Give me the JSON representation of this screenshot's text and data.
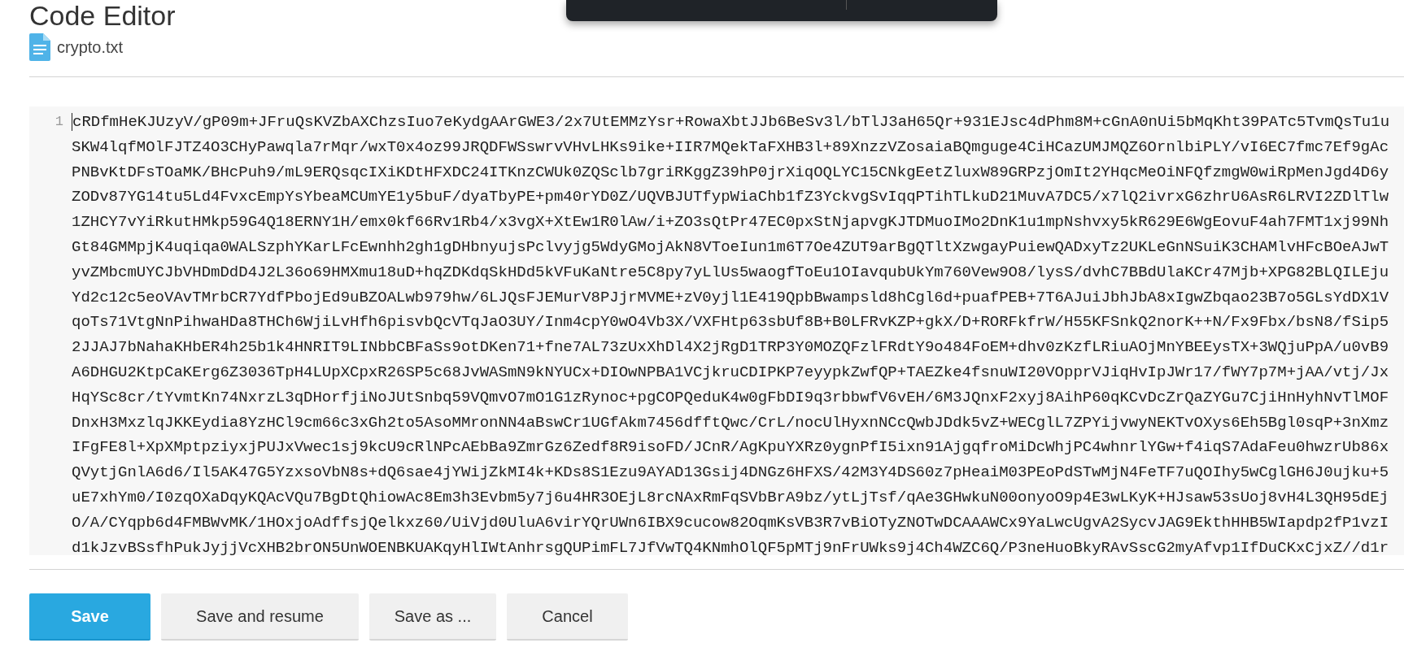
{
  "title": "Code Editor",
  "file": {
    "name": "crypto.txt"
  },
  "editor": {
    "lines": [
      {
        "number": "1",
        "cursor": true,
        "rows": [
          "cRDfmHeKJUzyV/gP09m+JFruQsKVZbAXChzsIuo7eKydgAArGWE3/2x7UtEMMzYsr+RowaXbtJJb6BeSv3l/bTlJ3aH65Qr+931EJsc4dPhm8M+cGnA0nUi5bMqKht39PATc5TvmQsTu1u",
          "SKW4lqfMOlFJTZ4O3CHyPawqla7rMqr/wxT0x4oz99JRQDFWSswrvVHvLHKs9ike+IIR7MQekTaFXHB3l+89XnzzVZosaiaBQmguge4CiHCazUMJMQZ6OrnlbiPLY/vI6EC7fmc7Ef9gAc",
          "PNBvKtDFsTOaMK/BHcPuh9/mL9ERQsqcIXiKDtHFXDC24ITKnzCWUk0ZQSclb7griRKggZ39hP0jrXiqOQLYC15CNkgEetZluxW89GRPzjOmIt2YHqcMeOiNFQfzmgW0wiRpMenJgd4D6y",
          "ZODv87YG14tu5Ld4FvxcEmpYsYbeaMCUmYE1y5buF/dyaTbyPE+pm40rYD0Z/UQVBJUTfypWiaChb1fZ3YckvgSvIqqPTihTLkuD21MuvA7DC5/x7lQ2ivrxG6zhrU6AsR6LRVI2ZDlTlw",
          "1ZHCY7vYiRkutHMkp59G4Q18ERNY1H/emx0kf66Rv1Rb4/x3vgX+XtEw1R0lAw/i+ZO3sQtPr47EC0pxStNjapvgKJTDMuoIMo2DnK1u1mpNshvxy5kR629E6WgEovuF4ah7FMT1xj99Nh",
          "Gt84GMMpjK4uqiqa0WALSzphYKarLFcEwnhh2gh1gDHbnyujsPclvyjg5WdyGMojAkN8VToeIun1m6T7Oe4ZUT9arBgQTltXzwgayPuiewQADxyTz2UKLeGnNSuiK3CHAMlvHFcBOeAJwT",
          "yvZMbcmUYCJbVHDmDdD4J2L36o69HMXmu18uD+hqZDKdqSkHDd5kVFuKaNtre5C8py7yLlUs5waogfToEu1OIavqubUkYm760Vew9O8/lysS/dvhC7BBdUlaKCr47Mjb+XPG82BLQILEju",
          "Yd2c12c5eoVAvTMrbCR7YdfPbojEd9uBZOALwb979hw/6LJQsFJEMurV8PJjrMVME+zV0yjl1E419QpbBwampsld8hCgl6d+puafPEB+7T6AJuiJbhJbA8xIgwZbqao23B7o5GLsYdDX1V",
          "qoTs71VtgNnPihwaHDa8THCh6WjiLvHfh6pisvbQcVTqJaO3UY/Inm4cpY0wO4Vb3X/VXFHtp63sbUf8B+B0LFRvKZP+gkX/D+RORFkfrW/H55KFSnkQ2norK++N/Fx9Fbx/bsN8/fSip5",
          "2JJAJ7bNahaKHbER4h25b1k4HNRIT9LINbbCBFaSs9otDKen71+fne7AL73zUxXhDl4X2jRgD1TRP3Y0MOZQFzlFRdtY9o484FoEM+dhv0zKzfLRiuAOjMnYBEEysTX+3WQjuPpA/u0vB9",
          "A6DHGU2KtpCaKErg6Z3036TpH4LUpXCpxR26SP5c68JvWASmN9kNYUCx+DIOwNPBA1VCjkruCDIPKP7eyypkZwfQP+TAEZke4fsnuWI20VOpprVJiqHvIpJWr17/fWY7p7M+jAA/vtj/Jx",
          "HqYSc8cr/tYvmtKn74NxrzL3qDHorfjiNoJUtSnbq59VQmvO7mO1G1zRynoc+pgCOPQeduK4w0gFbDI9q3rbbwfV6vEH/6M3JQnxF2xyj8AihP60qKCvDcZrQaZYGu7CjiHnHyhNvTlMOF",
          "DnxH3MxzlqJKKEydia8YzHCl9cm66c3xGh2to5AsoMMronNN4aBswCr1UGfAkm7456dfftQwc/CrL/nocUlHyxnNCcQwbJDdk5vZ+WECglL7ZPYijvwyNEKTvOXys6Eh5Bgl0sqP+3nXmz",
          "IFgFE8l+XpXMptpziyxjPUJxVwec1sj9kcU9cRlNPcAEbBa9ZmrGz6Zedf8R9isoFD/JCnR/AgKpuYXRz0ygnPfI5ixn91AjgqfroMiDcWhjPC4whnrlYGw+f4iqS7AdaFeu0hwzrUb86x",
          "QVytjGnlA6d6/Il5AK47G5YzxsoVbN8s+dQ6sae4jYWijZkMI4k+KDs8S1Ezu9AYAD13Gsij4DNGz6HFXS/42M3Y4DS60z7pHeaiM03PEoPdSTwMjN4FeTF7uQOIhy5wCglGH6J0ujku+5",
          "uE7xhYm0/I0zqOXaDqyKQAcVQu7BgDtQhiowAc8Em3h3Evbm5y7j6u4HR3OEjL8rcNAxRmFqSVbBrA9bz/ytLjTsf/qAe3GHwkuN00onyoO9p4E3wLKyK+HJsaw53sUoj8vH4L3QH95dEj",
          "O/A/CYqpb6d4FMBWvMK/1HOxjoAdffsjQelkxz60/UiVjd0UluA6virYQrUWn6IBX9cucow82OqmKsVB3R7vBiOTyZNOTwDCAAAWCx9YaLwcUgvA2SycvJAG9EkthHHB5WIapdp2fP1vzI",
          "d1kJzvBSsfhPukJyjjVcXHB2brON5UnWOENBKUAKqyHlIWtAnhrsgQUPimFL7JfVwTQ4KNmhOlQF5pMTj9nFrUWks9j4Ch4WZC6Q/P3neHuoBkyRAvSscG2myAfvp1IfDuCKxCjxZ//d1r"
        ]
      }
    ]
  },
  "buttons": [
    {
      "label": "Save",
      "kind": "primary"
    },
    {
      "label": "Save and resume",
      "kind": "secondary"
    },
    {
      "label": "Save as ...",
      "kind": "secondary"
    },
    {
      "label": "Cancel",
      "kind": "secondary"
    }
  ]
}
